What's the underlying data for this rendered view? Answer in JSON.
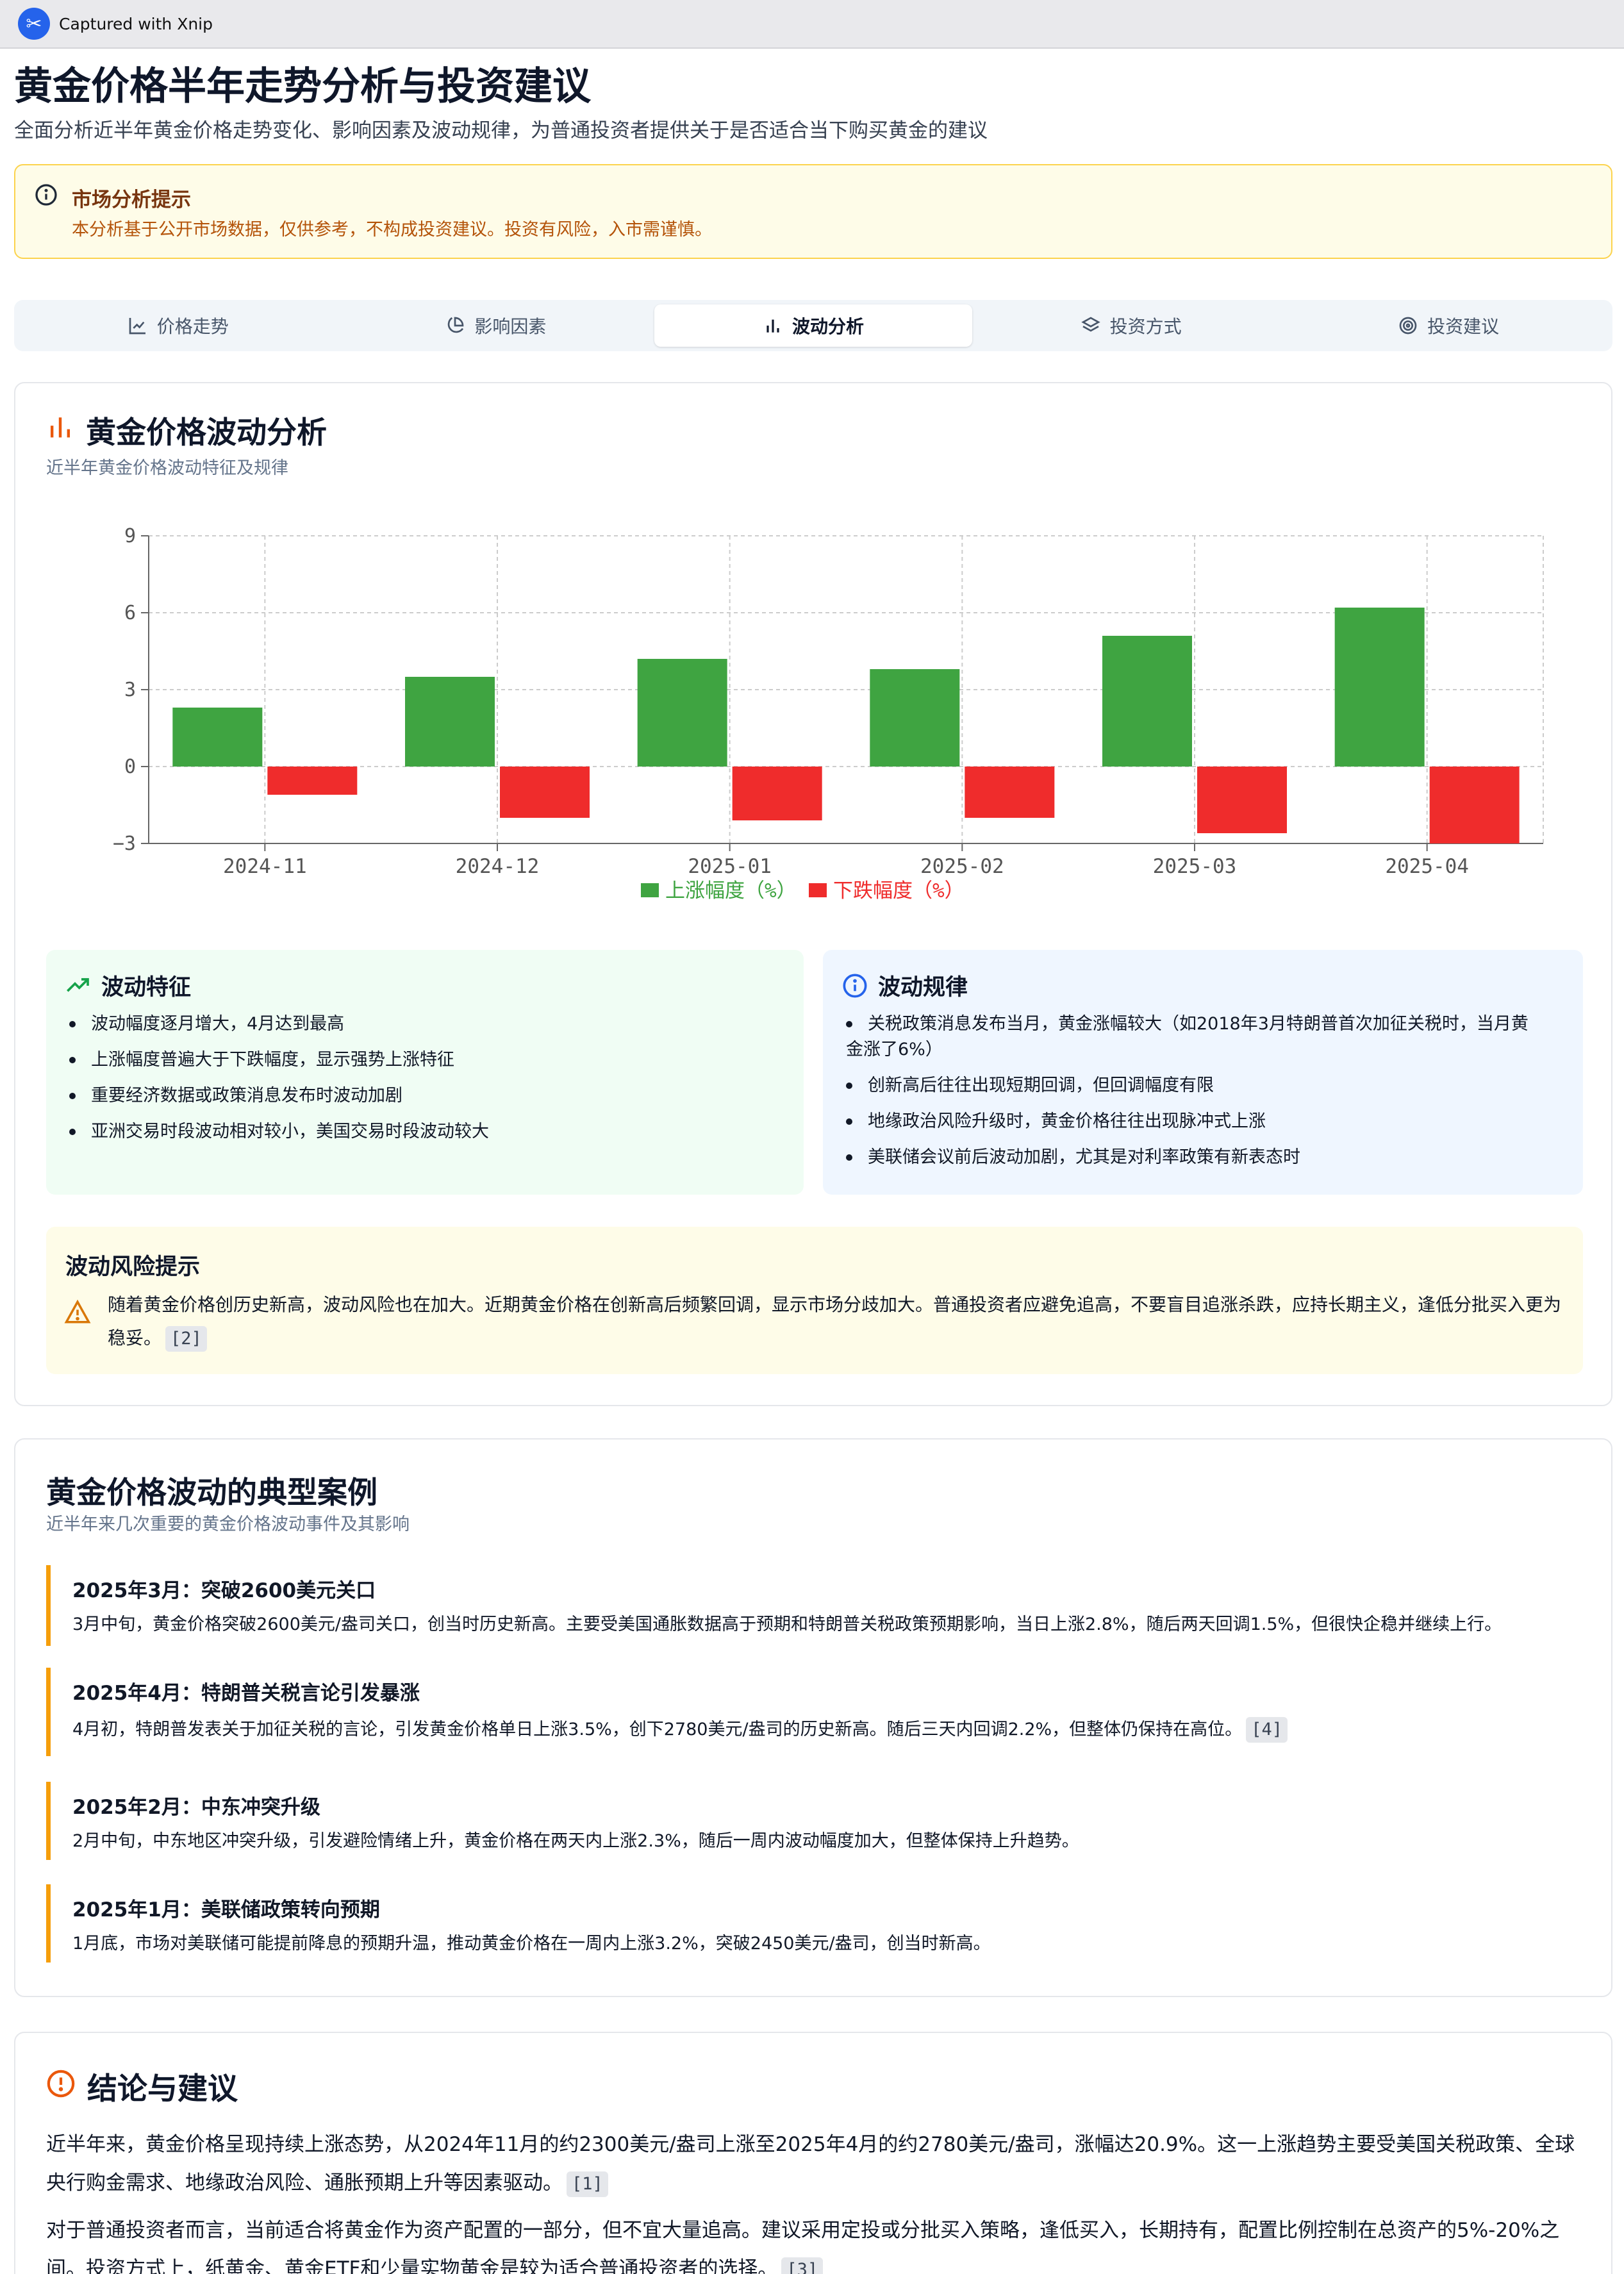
{
  "window": {
    "title": "Captured with Xnip"
  },
  "page": {
    "title": "黄金价格半年走势分析与投资建议",
    "subtitle": "全面分析近半年黄金价格走势变化、影响因素及波动规律，为普通投资者提供关于是否适合当下购买黄金的建议"
  },
  "notice": {
    "title": "市场分析提示",
    "text": "本分析基于公开市场数据，仅供参考，不构成投资建议。投资有风险，入市需谨慎。"
  },
  "tabs": [
    {
      "label": "价格走势",
      "icon": "line-chart-icon",
      "active": false
    },
    {
      "label": "影响因素",
      "icon": "pie-chart-icon",
      "active": false
    },
    {
      "label": "波动分析",
      "icon": "bar-chart-icon",
      "active": true
    },
    {
      "label": "投资方式",
      "icon": "layers-icon",
      "active": false
    },
    {
      "label": "投资建议",
      "icon": "target-icon",
      "active": false
    }
  ],
  "volatility": {
    "title": "黄金价格波动分析",
    "subtitle": "近半年黄金价格波动特征及规律"
  },
  "chart_data": {
    "type": "bar",
    "categories": [
      "2024-11",
      "2024-12",
      "2025-01",
      "2025-02",
      "2025-03",
      "2025-04"
    ],
    "series": [
      {
        "name": "上涨幅度（%）",
        "color": "#3fa441",
        "values": [
          2.3,
          3.5,
          4.2,
          3.8,
          5.1,
          6.2
        ]
      },
      {
        "name": "下跌幅度（%）",
        "color": "#ef2c2c",
        "values": [
          -1.1,
          -2.0,
          -2.1,
          -2.0,
          -2.6,
          -3.0
        ]
      }
    ],
    "yticks": [
      9,
      6,
      3,
      0,
      -3
    ],
    "ylim": [
      -3,
      9
    ],
    "grid": true,
    "legend_position": "bottom-center"
  },
  "features": {
    "title": "波动特征",
    "items": [
      "波动幅度逐月增大，4月达到最高",
      "上涨幅度普遍大于下跌幅度，显示强势上涨特征",
      "重要经济数据或政策消息发布时波动加剧",
      "亚洲交易时段波动相对较小，美国交易时段波动较大"
    ]
  },
  "patterns": {
    "title": "波动规律",
    "item1_line1": "关税政策消息发布当月，黄金涨幅较大（如2018年3月特朗普首次加征关税时，当月黄",
    "item1_line2": "金涨了6%）",
    "items": [
      "创新高后往往出现短期回调，但回调幅度有限",
      "地缘政治风险升级时，黄金价格往往出现脉冲式上涨",
      "美联储会议前后波动加剧，尤其是对利率政策有新表态时"
    ]
  },
  "risk": {
    "title": "波动风险提示",
    "text": "随着黄金价格创历史新高，波动风险也在加大。近期黄金价格在创新高后频繁回调，显示市场分歧加大。普通投资者应避免追高，不要盲目追涨杀跌，应持长期主义，逢低分批买入更为稳妥。",
    "cite": "[2]"
  },
  "cases": {
    "title": "黄金价格波动的典型案例",
    "subtitle": "近半年来几次重要的黄金价格波动事件及其影响",
    "items": [
      {
        "title": "2025年3月：突破2600美元关口",
        "text": "3月中旬，黄金价格突破2600美元/盎司关口，创当时历史新高。主要受美国通胀数据高于预期和特朗普关税政策预期影响，当日上涨2.8%，随后两天回调1.5%，但很快企稳并继续上行。",
        "cite": ""
      },
      {
        "title": "2025年4月：特朗普关税言论引发暴涨",
        "text": "4月初，特朗普发表关于加征关税的言论，引发黄金价格单日上涨3.5%，创下2780美元/盎司的历史新高。随后三天内回调2.2%，但整体仍保持在高位。",
        "cite": "[4]"
      },
      {
        "title": "2025年2月：中东冲突升级",
        "text": "2月中旬，中东地区冲突升级，引发避险情绪上升，黄金价格在两天内上涨2.3%，随后一周内波动幅度加大，但整体保持上升趋势。",
        "cite": ""
      },
      {
        "title": "2025年1月：美联储政策转向预期",
        "text": "1月底，市场对美联储可能提前降息的预期升温，推动黄金价格在一周内上涨3.2%，突破2450美元/盎司，创当时新高。",
        "cite": ""
      }
    ]
  },
  "conclusion": {
    "title": "结论与建议",
    "p1": "近半年来，黄金价格呈现持续上涨态势，从2024年11月的约2300美元/盎司上涨至2025年4月的约2780美元/盎司，涨幅达20.9%。这一上涨趋势主要受美国关税政策、全球央行购金需求、地缘政治风险、通胀预期上升等因素驱动。",
    "p1_cite": "[1]",
    "p2": "对于普通投资者而言，当前适合将黄金作为资产配置的一部分，但不宜大量追高。建议采用定投或分批买入策略，逢低买入，长期持有，配置比例控制在总资产的5%-20%之间。投资方式上，纸黄金、黄金ETF和少量实物黄金是较为适合普通投资者的选择。",
    "p2_cite": "[3]"
  }
}
